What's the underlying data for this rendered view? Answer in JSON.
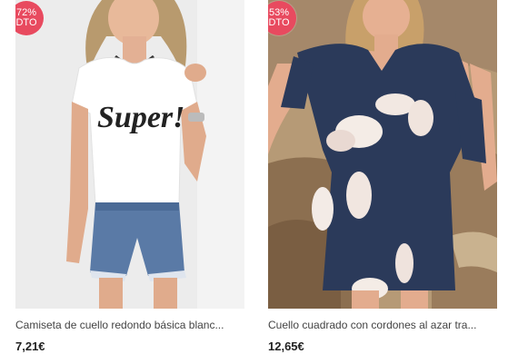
{
  "products": [
    {
      "discount_percent": "72%",
      "discount_label": "DTO",
      "title": "Camiseta de cuello redondo básica blanc...",
      "price": "7,21€",
      "shirt_text": "Super!"
    },
    {
      "discount_percent": "53%",
      "discount_label": "DTO",
      "title": "Cuello cuadrado con cordones al azar tra...",
      "price": "12,65€"
    }
  ],
  "colors": {
    "badge": "#e84a5f",
    "left_background": "#e9e9e9",
    "right_dress": "#2b3a5a"
  }
}
